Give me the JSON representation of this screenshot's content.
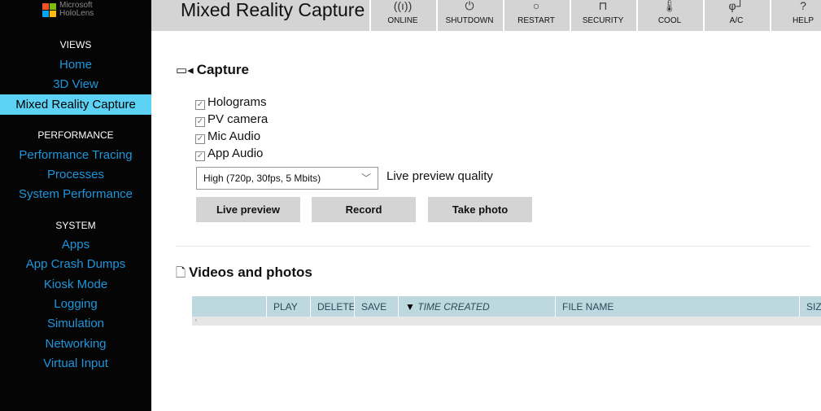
{
  "brand": {
    "line1": "Microsoft",
    "line2": "HoloLens"
  },
  "sidebar": {
    "sections": [
      {
        "title": "VIEWS",
        "items": [
          "Home",
          "3D View",
          "Mixed Reality Capture"
        ]
      },
      {
        "title": "PERFORMANCE",
        "items": [
          "Performance Tracing",
          "Processes",
          "System Performance"
        ]
      },
      {
        "title": "SYSTEM",
        "items": [
          "Apps",
          "App Crash Dumps",
          "Kiosk Mode",
          "Logging",
          "Simulation",
          "Networking",
          "Virtual Input"
        ]
      }
    ],
    "selected": "Mixed Reality Capture"
  },
  "header": {
    "title": "Mixed Reality Capture",
    "buttons": [
      {
        "label": "ONLINE",
        "icon": "wifi-icon"
      },
      {
        "label": "SHUTDOWN",
        "icon": "power-icon"
      },
      {
        "label": "RESTART",
        "icon": "restart-icon"
      },
      {
        "label": "SECURITY",
        "icon": "lock-icon"
      },
      {
        "label": "COOL",
        "icon": "thermometer-icon"
      },
      {
        "label": "A/C",
        "icon": "plug-icon"
      },
      {
        "label": "HELP",
        "icon": "help-icon"
      }
    ]
  },
  "capture": {
    "title": "Capture",
    "options": [
      {
        "label": "Holograms",
        "checked": true
      },
      {
        "label": "PV camera",
        "checked": true
      },
      {
        "label": "Mic Audio",
        "checked": true
      },
      {
        "label": "App Audio",
        "checked": true
      }
    ],
    "quality": {
      "value": "High (720p, 30fps, 5 Mbits)",
      "label": "Live preview quality"
    },
    "buttons": {
      "live_preview": "Live preview",
      "record": "Record",
      "take_photo": "Take photo"
    }
  },
  "videos": {
    "title": "Videos and photos",
    "columns": [
      "",
      "PLAY",
      "DELETE",
      "SAVE",
      "TIME CREATED",
      "FILE NAME",
      "SIZ"
    ],
    "sort_arrow": "▼",
    "scroll_left": "‹"
  }
}
